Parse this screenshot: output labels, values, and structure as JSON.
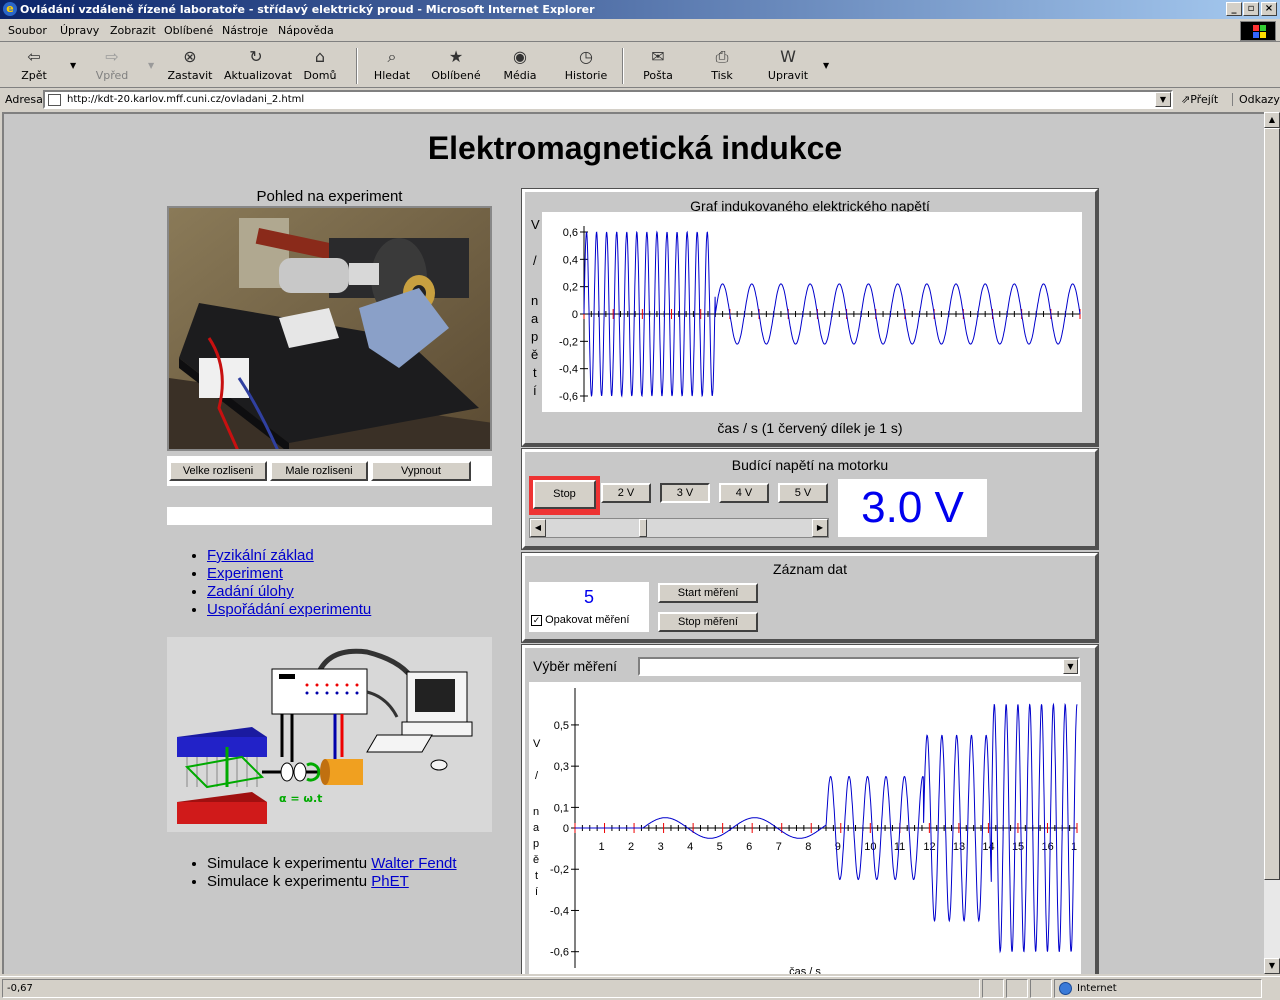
{
  "window": {
    "title": "Ovládání vzdáleně řízené laboratoře - střídavý elektrický proud - Microsoft Internet Explorer"
  },
  "menu": [
    "Soubor",
    "Úpravy",
    "Zobrazit",
    "Oblíbené",
    "Nástroje",
    "Nápověda"
  ],
  "toolbar": {
    "back": "Zpět",
    "forward": "Vpřed",
    "stop": "Zastavit",
    "refresh": "Aktualizovat",
    "home": "Domů",
    "search": "Hledat",
    "favorites": "Oblíbené",
    "media": "Média",
    "history": "Historie",
    "mail": "Pošta",
    "print": "Tisk",
    "edit": "Upravit"
  },
  "address": {
    "label": "Adresa",
    "url": "http://kdt-20.karlov.mff.cuni.cz/ovladani_2.html",
    "go": "Přejít",
    "links": "Odkazy"
  },
  "page": {
    "title": "Elektromagnetická indukce",
    "camera": {
      "caption": "Pohled na experiment",
      "buttons": [
        "Velke rozliseni",
        "Male rozliseni",
        "Vypnout"
      ]
    },
    "links": [
      "Fyzikální základ",
      "Experiment",
      "Zadání úlohy",
      "Uspořádání experimentu"
    ],
    "diagram_formula": "α = ω.t",
    "simulations": [
      {
        "text": "Simulace k experimentu ",
        "link": "Walter Fendt"
      },
      {
        "text": "Simulace k experimentu ",
        "link": "PhET"
      }
    ],
    "graph1": {
      "title": "Graf indukovaného elektrického napětí",
      "xcaption": "čas / s (1 červený dílek je 1 s)",
      "ylabel_chars": [
        "V",
        "/",
        "n",
        "a",
        "p",
        "ě",
        "t",
        "í"
      ]
    },
    "motor": {
      "title": "Budící napětí na motorku",
      "stop": "Stop",
      "voltages": [
        "2 V",
        "3 V",
        "4 V",
        "5 V"
      ],
      "selected": "3 V",
      "display": "3.0 V",
      "slider_fraction": 0.36
    },
    "record": {
      "title": "Záznam dat",
      "count": "5",
      "repeat_label": "Opakovat měření",
      "repeat_checked": true,
      "start": "Start měření",
      "stop": "Stop měření"
    },
    "graph2": {
      "select_label": "Výběr měření",
      "xcaption": "čas / s",
      "ylabel_chars": [
        "V",
        "/",
        "n",
        "a",
        "p",
        "ě",
        "t",
        "í"
      ]
    }
  },
  "status": {
    "text": "-0,67",
    "zone": "Internet"
  },
  "chart_data": [
    {
      "type": "line",
      "title": "Graf indukovaného elektrického napětí",
      "xlabel": "čas / s (1 červený dílek je 1 s)",
      "ylabel": "V / napětí",
      "yticks": [
        "0,6",
        "0,4",
        "0,2",
        "0",
        "-0,2",
        "-0,4",
        "-0,6"
      ],
      "ylim": [
        -0.6,
        0.6
      ],
      "xlim": [
        0,
        17
      ],
      "segments": [
        {
          "from": 0,
          "to": 4.5,
          "amplitude": 0.6,
          "frequency_hz": 2.9
        },
        {
          "from": 4.5,
          "to": 17,
          "amplitude": 0.22,
          "frequency_hz": 1.0
        }
      ],
      "color": "#0000cc"
    },
    {
      "type": "line",
      "xlabel": "čas / s",
      "ylabel": "V / napětí",
      "yticks": [
        "0,5",
        "0,3",
        "0,1",
        "0",
        "-0,2",
        "-0,4",
        "-0,6"
      ],
      "xticks": [
        "1",
        "2",
        "3",
        "4",
        "5",
        "6",
        "7",
        "8",
        "9",
        "10",
        "11",
        "12",
        "13",
        "14",
        "15",
        "16",
        "1"
      ],
      "ylim": [
        -0.65,
        0.65
      ],
      "xlim": [
        0,
        17
      ],
      "segments": [
        {
          "from": 0,
          "to": 2.3,
          "amplitude": 0.0,
          "frequency_hz": 0
        },
        {
          "from": 2.3,
          "to": 8.5,
          "amplitude": 0.05,
          "frequency_hz": 0.33
        },
        {
          "from": 8.5,
          "to": 11.8,
          "amplitude": 0.25,
          "frequency_hz": 1.6
        },
        {
          "from": 11.8,
          "to": 14.1,
          "amplitude": 0.45,
          "frequency_hz": 2.0
        },
        {
          "from": 14.1,
          "to": 17,
          "amplitude": 0.6,
          "frequency_hz": 2.5
        }
      ],
      "color": "#0000cc"
    }
  ]
}
